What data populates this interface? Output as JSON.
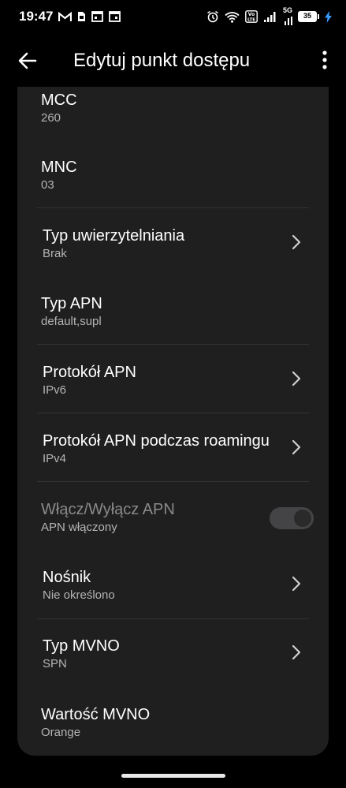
{
  "status_bar": {
    "time": "19:47",
    "network": "5G",
    "battery": "35"
  },
  "header": {
    "title": "Edytuj punkt dostępu"
  },
  "rows": [
    {
      "title": "MCC",
      "value": "260"
    },
    {
      "title": "MNC",
      "value": "03"
    },
    {
      "title": "Typ uwierzytelniania",
      "value": "Brak"
    },
    {
      "title": "Typ APN",
      "value": "default,supl"
    },
    {
      "title": "Protokół APN",
      "value": "IPv6"
    },
    {
      "title": "Protokół APN podczas roamingu",
      "value": "IPv4"
    },
    {
      "title": "Włącz/Wyłącz APN",
      "value": "APN włączony"
    },
    {
      "title": "Nośnik",
      "value": "Nie określono"
    },
    {
      "title": "Typ MVNO",
      "value": "SPN"
    },
    {
      "title": "Wartość MVNO",
      "value": "Orange"
    }
  ],
  "colors": {
    "background": "#000000",
    "card": "#1f1f20",
    "secondary_text": "#b4b4b4",
    "divider": "#333336"
  }
}
